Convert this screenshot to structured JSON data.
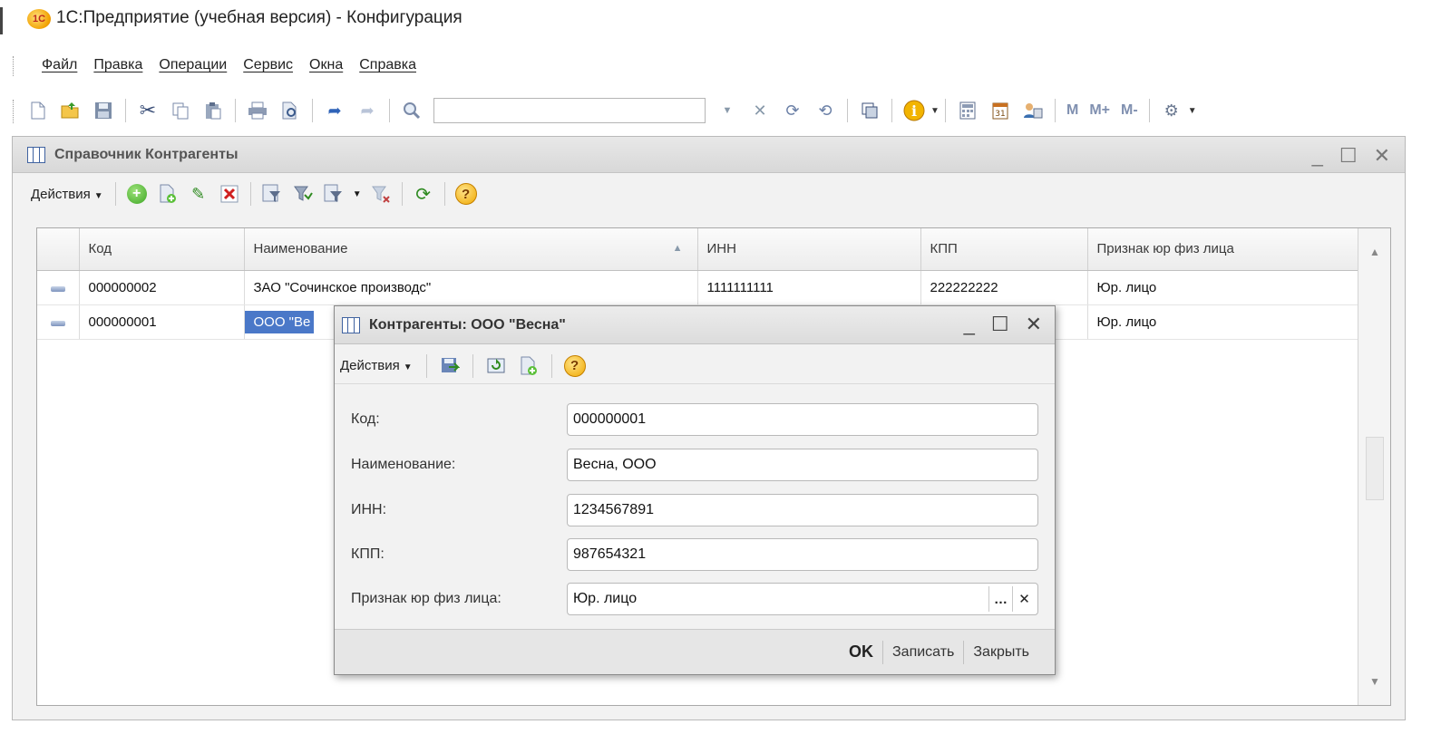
{
  "app": {
    "title": "1С:Предприятие (учебная версия) - Конфигурация",
    "logo_text": "1С"
  },
  "menu": {
    "items": [
      "Файл",
      "Правка",
      "Операции",
      "Сервис",
      "Окна",
      "Справка"
    ]
  },
  "toolbar": {
    "search_value": "",
    "memory_buttons": [
      "M",
      "M+",
      "M-"
    ],
    "icons": [
      "new-document-icon",
      "open-icon",
      "save-icon",
      "cut-icon",
      "copy-icon",
      "paste-icon",
      "print-icon",
      "print-preview-icon",
      "back-icon",
      "forward-icon",
      "search-icon",
      "find-next-icon",
      "find-prev-icon",
      "window-icon",
      "info-icon",
      "calculator-icon",
      "calendar-icon",
      "users-icon",
      "settings-icon"
    ]
  },
  "catalog": {
    "title": "Справочник Контрагенты",
    "actions_label": "Действия",
    "columns": [
      "Код",
      "Наименование",
      "ИНН",
      "КПП",
      "Признак юр физ лица"
    ],
    "rows": [
      {
        "code": "000000002",
        "name": "ЗАО \"Сочинское производс\"",
        "inn": "1111111111",
        "kpp": "222222222",
        "type": "Юр. лицо"
      },
      {
        "code": "000000001",
        "name": "ООО \"Ве",
        "inn": "",
        "kpp": "",
        "type": "Юр. лицо"
      }
    ]
  },
  "dialog": {
    "title": "Контрагенты: ООО \"Весна\"",
    "actions_label": "Действия",
    "fields": {
      "code": {
        "label": "Код:",
        "value": "000000001"
      },
      "name": {
        "label": "Наименование:",
        "value": "Весна, ООО"
      },
      "inn": {
        "label": "ИНН:",
        "value": "1234567891"
      },
      "kpp": {
        "label": "КПП:",
        "value": "987654321"
      },
      "type": {
        "label": "Признак юр физ лица:",
        "value": "Юр. лицо"
      }
    },
    "buttons": {
      "ok": "OK",
      "save": "Записать",
      "close": "Закрыть"
    }
  },
  "colors": {
    "selection": "#4a78c8",
    "window_bg": "#f2f2f2",
    "accent_icon": "#4a6a9a"
  }
}
